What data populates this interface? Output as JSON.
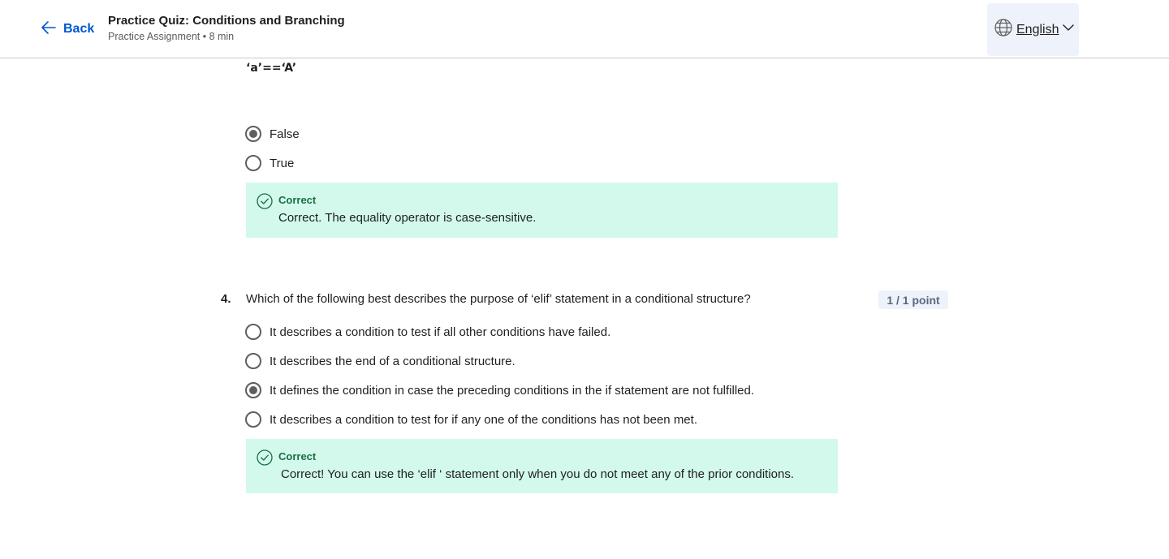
{
  "header": {
    "back_label": "Back",
    "title": "Practice Quiz: Conditions and Branching",
    "subtitle": "Practice Assignment • 8 min",
    "language": "English"
  },
  "question3": {
    "statement": "‘a’==‘A’",
    "options": [
      {
        "label": "False",
        "selected": true
      },
      {
        "label": "True",
        "selected": false
      }
    ],
    "feedback": {
      "status": "Correct",
      "text": "Correct. The equality operator is case-sensitive."
    }
  },
  "question4": {
    "number": "4.",
    "text": "Which of the following best describes the purpose of ‘elif’ statement in a conditional structure?",
    "points": "1 / 1 point",
    "options": [
      {
        "label": "It describes a condition to test if all other conditions have failed.",
        "selected": false
      },
      {
        "label": "It describes the end of a conditional structure.",
        "selected": false
      },
      {
        "label": "It defines the condition in case the preceding conditions in the if statement are not fulfilled.",
        "selected": true
      },
      {
        "label": "It describes a condition to test for if any one of the conditions has not been met.",
        "selected": false
      }
    ],
    "feedback": {
      "status": "Correct",
      "text": "Correct! You can use the ‘elif ‘ statement only when you do not meet any of the prior conditions."
    }
  },
  "colors": {
    "accent": "#0056d2",
    "feedback_bg": "#d2f9ec",
    "feedback_green": "#1b6e46"
  }
}
